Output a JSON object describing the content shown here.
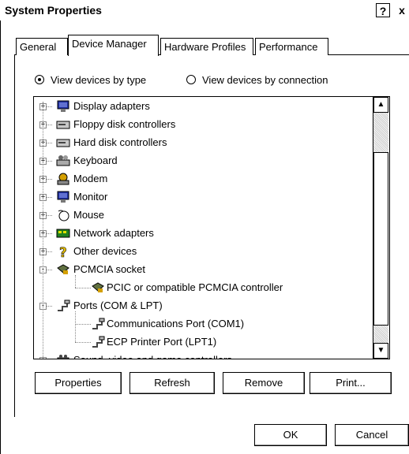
{
  "window": {
    "title": "System Properties",
    "help": "?",
    "close": "x"
  },
  "tabs": [
    {
      "label": "General",
      "active": false
    },
    {
      "label": "Device Manager",
      "active": true
    },
    {
      "label": "Hardware Profiles",
      "active": false
    },
    {
      "label": "Performance",
      "active": false
    }
  ],
  "view_options": [
    {
      "label": "View devices by type",
      "selected": true
    },
    {
      "label": "View devices by connection",
      "selected": false
    }
  ],
  "tree": [
    {
      "label": "Display adapters",
      "icon": "monitor-icon",
      "expander": "+"
    },
    {
      "label": "Floppy disk controllers",
      "icon": "disk-controller-icon",
      "expander": "+"
    },
    {
      "label": "Hard disk controllers",
      "icon": "disk-controller-icon",
      "expander": "+"
    },
    {
      "label": "Keyboard",
      "icon": "keyboard-icon",
      "expander": "+"
    },
    {
      "label": "Modem",
      "icon": "modem-icon",
      "expander": "+"
    },
    {
      "label": "Monitor",
      "icon": "monitor-icon",
      "expander": "+"
    },
    {
      "label": "Mouse",
      "icon": "mouse-icon",
      "expander": "+"
    },
    {
      "label": "Network adapters",
      "icon": "network-adapter-icon",
      "expander": "+"
    },
    {
      "label": "Other devices",
      "icon": "question-mark-icon",
      "expander": "+"
    },
    {
      "label": "PCMCIA socket",
      "icon": "pcmcia-icon",
      "expander": "-"
    },
    {
      "label": "PCIC or compatible PCMCIA controller",
      "icon": "pcmcia-icon",
      "expander": "",
      "child": true
    },
    {
      "label": "Ports (COM & LPT)",
      "icon": "port-icon",
      "expander": "-"
    },
    {
      "label": "Communications Port (COM1)",
      "icon": "port-icon",
      "expander": "",
      "child": true
    },
    {
      "label": "ECP Printer Port (LPT1)",
      "icon": "port-icon",
      "expander": "",
      "child": true
    },
    {
      "label": "Sound, video and game controllers",
      "icon": "sound-icon",
      "expander": "+"
    }
  ],
  "buttons": {
    "properties": "Properties",
    "refresh": "Refresh",
    "remove": "Remove",
    "print": "Print...",
    "ok": "OK",
    "cancel": "Cancel"
  }
}
